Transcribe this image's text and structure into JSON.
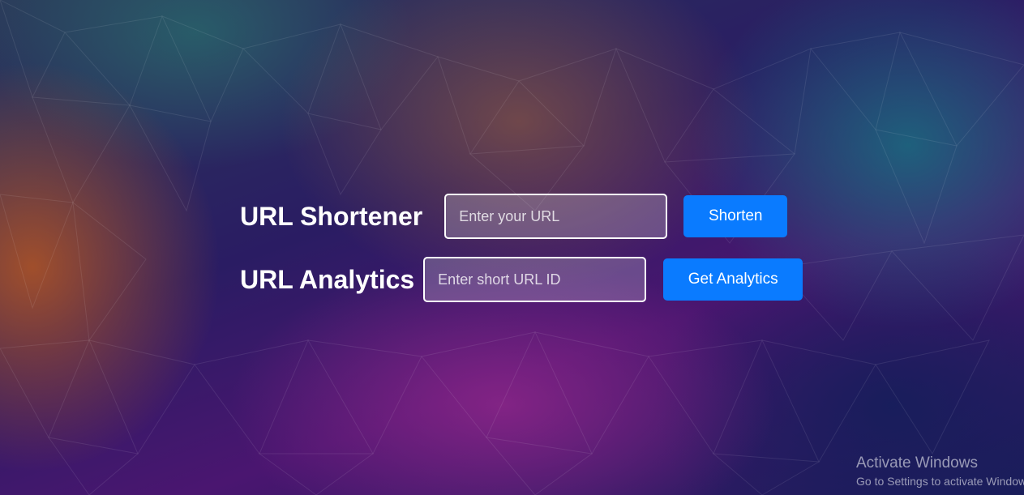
{
  "shortener": {
    "title": "URL Shortener",
    "input_placeholder": "Enter your URL",
    "button_label": "Shorten"
  },
  "analytics": {
    "title": "URL Analytics",
    "input_placeholder": "Enter short URL ID",
    "button_label": "Get Analytics"
  },
  "watermark": {
    "title": "Activate Windows",
    "subtitle": "Go to Settings to activate Windows."
  },
  "colors": {
    "button": "#0a7bff",
    "text": "#ffffff"
  }
}
